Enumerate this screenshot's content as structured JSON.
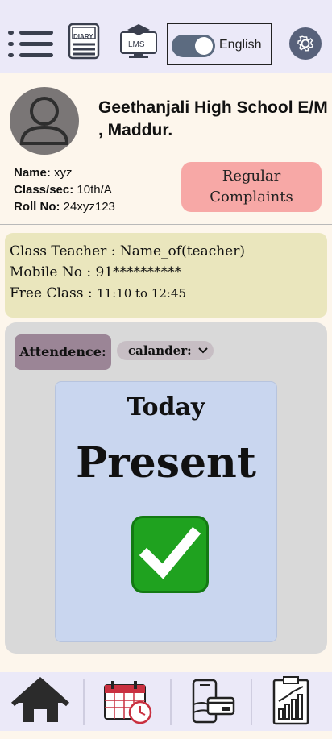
{
  "header": {
    "menu_icon": "hamburger-menu-icon",
    "diary_label": "DIARY",
    "lms_label": "LMS",
    "language_label": "English",
    "language_toggle_on": true,
    "settings_icon": "gear-icon"
  },
  "profile": {
    "avatar_icon": "user-avatar-icon",
    "school_name": "Geethanjali High School E/M , Maddur.",
    "name_label": "Name:",
    "name_value": "xyz",
    "class_label": "Class/sec:",
    "class_value": "10th/A",
    "roll_label": "Roll No:",
    "roll_value": "24xyz123",
    "complaints_button": "Regular Complaints"
  },
  "teacher_card": {
    "teacher_line": "Class Teacher : Name_of(teacher)",
    "mobile_line": "Mobile No : 91**********",
    "free_class_label": "Free Class : ",
    "free_class_time": "11:10 to 12:45"
  },
  "attendance": {
    "label": "Attendence:",
    "calendar_dropdown": "calander:",
    "today_label": "Today",
    "status": "Present",
    "status_icon": "check-mark-icon"
  },
  "bottom_nav": {
    "items": [
      "home-icon",
      "calendar-clock-icon",
      "mobile-payment-icon",
      "report-chart-icon"
    ]
  },
  "colors": {
    "header_bg": "#ebe9f8",
    "page_bg": "#fdf6ec",
    "complaints_bg": "#f7a8a6",
    "teacher_card_bg": "#eae6bd",
    "attendance_panel_bg": "#d9d9d9",
    "attendance_label_bg": "#9b8596",
    "today_card_bg": "#c9d6ef",
    "present_check": "#1fa21f"
  }
}
